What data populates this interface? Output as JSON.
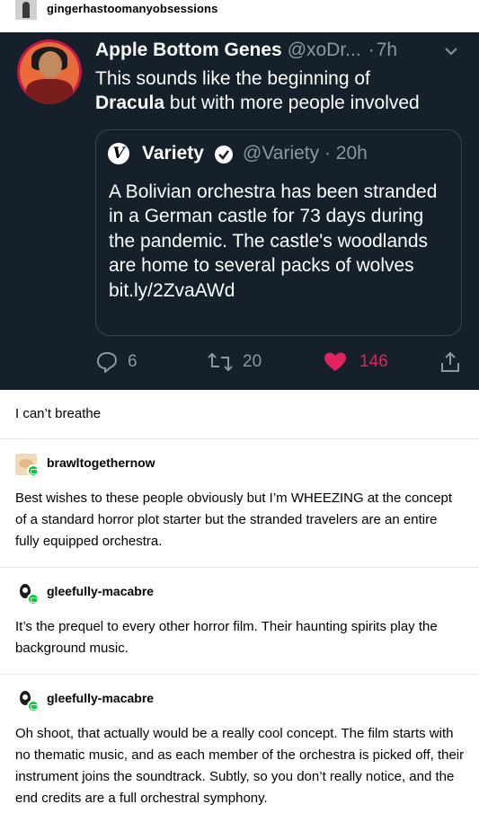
{
  "header": {
    "username": "gingerhastoomanyobsessions"
  },
  "tweet": {
    "name": "Apple Bottom Genes",
    "handle": "@xoDr...",
    "separator": "·",
    "time": "7h",
    "text_part1": "This sounds like the beginning of",
    "text_bold": "Dracula",
    "text_part2": "but with more people involved",
    "quote": {
      "logo": "V",
      "name": "Variety",
      "handle_time": "@Variety · 20h",
      "text": "A Bolivian orchestra has been stranded in a German castle for 73 days during the pandemic. The castle's woodlands are home to several packs of wolves bit.ly/2ZvaAWd"
    },
    "actions": {
      "replies": "6",
      "retweets": "20",
      "likes": "146"
    },
    "colors": {
      "background": "#15202b",
      "like": "#e0245e",
      "muted": "#8899a6"
    },
    "icons": [
      "reply-icon",
      "retweet-icon",
      "heart-icon",
      "share-icon",
      "verified-icon",
      "chevron-down-icon"
    ]
  },
  "caption": "I can’t breathe",
  "reblogs": [
    {
      "username": "brawltogethernow",
      "text": "Best wishes to these people obviously but I’m WHEEZING at the concept of a standard horror plot starter but the stranded travelers are an entire fully equipped orchestra."
    },
    {
      "username": "gleefully-macabre",
      "text": "It’s the prequel to every other horror film. Their haunting spirits play the background music."
    },
    {
      "username": "gleefully-macabre",
      "text": "Oh shoot, that actually would be a really cool concept. The film starts with no thematic music, and as each member of the orchestra is picked off, their instrument joins the soundtrack. Subtly, so you don’t really notice, and the end credits are a full orchestral symphony."
    }
  ]
}
